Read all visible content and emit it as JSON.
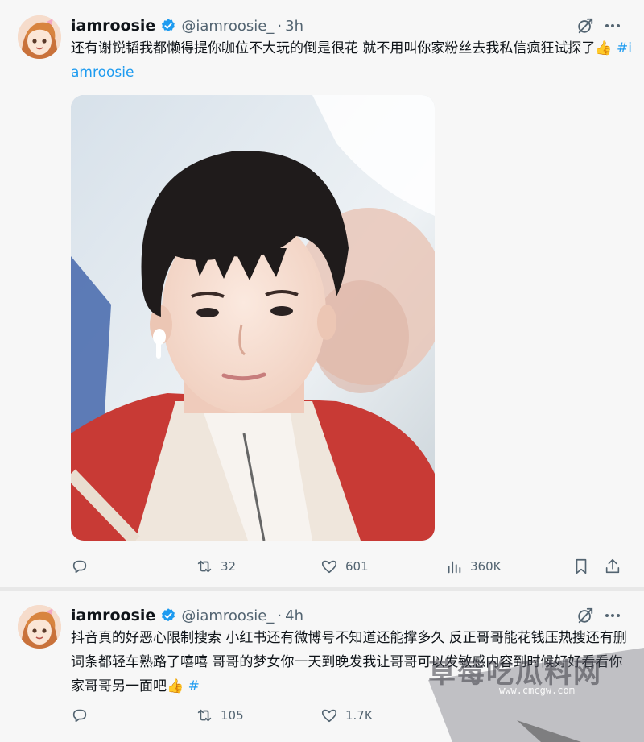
{
  "tweets": [
    {
      "name": "iamroosie",
      "handle": "@iamroosie_",
      "sep": "·",
      "time": "3h",
      "text": "还有谢锐韬我都懒得提你咖位不大玩的倒是很花 就不用叫你家粉丝去我私信疯狂试探了",
      "emoji": "👍",
      "hashtag": "#iamroosie",
      "replies": "",
      "retweets": "32",
      "likes": "601",
      "views": "360K"
    },
    {
      "name": "iamroosie",
      "handle": "@iamroosie_",
      "sep": "·",
      "time": "4h",
      "text": "抖音真的好恶心限制搜索 小红书还有微博号不知道还能撑多久 反正哥哥能花钱压热搜还有删词条都轻车熟路了嘻嘻 哥哥的梦女你一天到晚发我让哥哥可以发敏感内容到时候好好看看你家哥哥另一面吧",
      "emoji": "👍",
      "hashtag": "#",
      "replies": "",
      "retweets": "105",
      "likes": "1.7K"
    }
  ],
  "watermark": {
    "title": "草莓吃瓜料网",
    "url": "www.cmcgw.com"
  },
  "icons": {
    "verified": "verified-badge-icon",
    "grok": "grok-icon",
    "more": "more-icon",
    "reply": "reply-icon",
    "retweet": "retweet-icon",
    "like": "heart-icon",
    "views": "views-icon",
    "bookmark": "bookmark-icon",
    "share": "share-icon"
  },
  "colors": {
    "accent": "#1d9bf0",
    "muted": "#536471"
  }
}
